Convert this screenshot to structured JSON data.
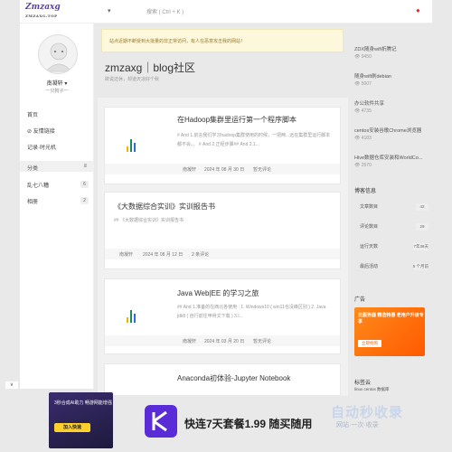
{
  "topbar": {
    "logo_main": "Zmzaxg",
    "logo_sub": "ZMZAXG.TOP",
    "nav_toggle": "▾",
    "search_placeholder": "搜索 ( Ctrl + K )",
    "bell": "●"
  },
  "profile": {
    "name": "南凝轩 ▾",
    "subtitle": "一只狗子一"
  },
  "left_menu": {
    "home": "首页",
    "friends": "友情链接",
    "records": "记录·时光机",
    "category_header": "分类",
    "categories": [
      {
        "label": "乱七八糟",
        "count": "6"
      },
      {
        "label": "相册",
        "count": "2"
      }
    ]
  },
  "notice": "站点近期不断受到大批量的非正常访问，有人在恶意攻击我的网站！",
  "blog": {
    "title": "zmzaxg｜blog社区",
    "subtitle": "欲说还休，却道天凉好个秋"
  },
  "posts": [
    {
      "title": "在Hadoop集群里运行第一个程序脚本",
      "summary": "# And 1.前言我们学习hadoop集群使用的时候，一把两...远在集群里运行脚本都不会。。 # And 2.正经步骤## And 2.1...",
      "author": "南凝轩",
      "date": "2024 年 08 月 30 日",
      "comments": "暂无评论"
    },
    {
      "title": "《大数据综合实训》实训报告书",
      "summary": "## 《大数据综合实训》实训报告书",
      "author": "南凝轩",
      "date": "2024 年 08 月 12 日",
      "comments": "2 条评论"
    },
    {
      "title": "Java Web|EE 的学习之旅",
      "summary": "## And 1.准备的在西北各使用 : 1. Windows10 ( win11也没峰区别 ) 2. Java jdk8 ( 自行前往甲骨文下载 ) 3.I...",
      "author": "南凝轩",
      "date": "2024 年 03 月 20 日",
      "comments": "暂无评论"
    },
    {
      "title": "Anaconda初体验-Jupyter Notebook",
      "summary": "",
      "author": "",
      "date": "",
      "comments": ""
    }
  ],
  "hot_posts": [
    {
      "title": "ZDX随身wifi折腾记",
      "views": "9450"
    },
    {
      "title": "随身wifi刷debian",
      "views": "5007"
    },
    {
      "title": "办公软件共享",
      "views": "4735"
    },
    {
      "title": "centos安装谷歌Chrome浏览器",
      "views": "4183"
    },
    {
      "title": "Hive数据仓库安装和WorldCo...",
      "views": "2570"
    }
  ],
  "blog_info": {
    "header": "博客信息",
    "rows": [
      {
        "label": "文章数目",
        "value": "42"
      },
      {
        "label": "评论数目",
        "value": "29"
      },
      {
        "label": "运行天数",
        "value": "7年36天"
      },
      {
        "label": "最后活动",
        "value": "5 个月前"
      }
    ]
  },
  "ads_header": "广告",
  "ad_block": {
    "text": "云服务器 精选特惠 老用户升级专享",
    "button": "立即抢购"
  },
  "tags": {
    "header": "标签云",
    "items": "linux   centos   数据库"
  },
  "bottom_ad": {
    "left_text": "3秒合成AI助力 畅游网能增强",
    "left_button": "加入快速",
    "main_text": "快连7天套餐1.99 随买随用",
    "brand": "自动秒收录",
    "brand_sub": "网站·一次·收录",
    "close": "∨"
  },
  "colors": {
    "accent": "#ff5a00",
    "notice_bg": "#fdf7dc",
    "logo": "#5b3fa8"
  }
}
